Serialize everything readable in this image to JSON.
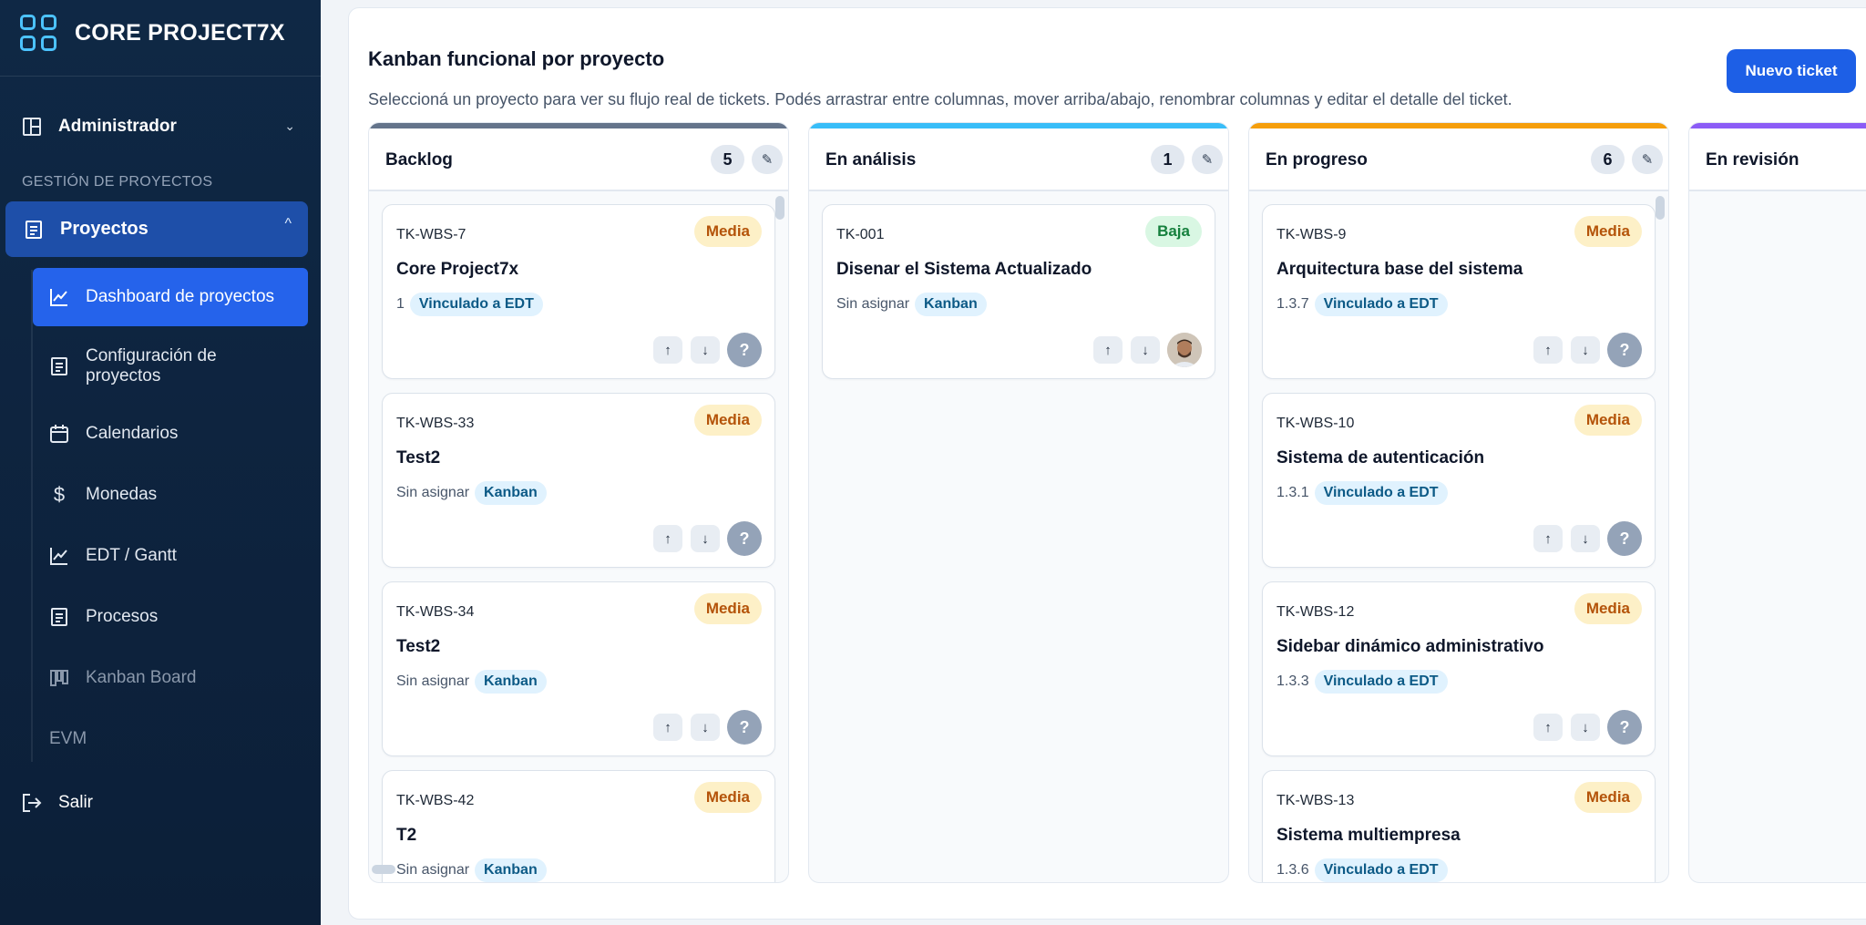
{
  "app": {
    "brand": "CORE PROJECT7X"
  },
  "sidebar": {
    "admin_label": "Administrador",
    "section_title": "GESTIÓN DE PROYECTOS",
    "projects_label": "Proyectos",
    "items": [
      {
        "label": "Dashboard de proyectos",
        "icon": "chart-line-icon"
      },
      {
        "label": "Configuración de proyectos",
        "icon": "document-icon"
      },
      {
        "label": "Calendarios",
        "icon": "calendar-icon"
      },
      {
        "label": "Monedas",
        "icon": "dollar-icon"
      },
      {
        "label": "EDT / Gantt",
        "icon": "chart-line-icon"
      },
      {
        "label": "Procesos",
        "icon": "document-icon"
      },
      {
        "label": "Kanban Board",
        "icon": "kanban-icon"
      },
      {
        "label": "EVM",
        "icon": ""
      }
    ],
    "exit_label": "Salir"
  },
  "main": {
    "title": "Kanban funcional por proyecto",
    "subtitle": "Seleccioná un proyecto para ver su flujo real de tickets. Podés arrastrar entre columnas, mover arriba/abajo, renombrar columnas y editar el detalle del ticket.",
    "new_ticket_label": "Nuevo ticket",
    "edit_symbol": "✎",
    "up_symbol": "↑",
    "down_symbol": "↓",
    "unassigned_symbol": "?"
  },
  "columns": [
    {
      "title": "Backlog",
      "count": "5",
      "accent": "#64748b",
      "cards": [
        {
          "code": "TK-WBS-7",
          "priority": "Media",
          "title": "Core Project7x",
          "meta": "1",
          "tag": "Vinculado a EDT"
        },
        {
          "code": "TK-WBS-33",
          "priority": "Media",
          "title": "Test2",
          "meta": "Sin asignar",
          "tag": "Kanban"
        },
        {
          "code": "TK-WBS-34",
          "priority": "Media",
          "title": "Test2",
          "meta": "Sin asignar",
          "tag": "Kanban"
        },
        {
          "code": "TK-WBS-42",
          "priority": "Media",
          "title": "T2",
          "meta": "Sin asignar",
          "tag": "Kanban"
        }
      ]
    },
    {
      "title": "En análisis",
      "count": "1",
      "accent": "#38bdf8",
      "cards": [
        {
          "code": "TK-001",
          "priority": "Baja",
          "title": "Disenar el Sistema Actualizado",
          "meta": "Sin asignar",
          "tag": "Kanban"
        }
      ]
    },
    {
      "title": "En progreso",
      "count": "6",
      "accent": "#f59e0b",
      "cards": [
        {
          "code": "TK-WBS-9",
          "priority": "Media",
          "title": "Arquitectura base del sistema",
          "meta": "1.3.7",
          "tag": "Vinculado a EDT"
        },
        {
          "code": "TK-WBS-10",
          "priority": "Media",
          "title": "Sistema de autenticación",
          "meta": "1.3.1",
          "tag": "Vinculado a EDT"
        },
        {
          "code": "TK-WBS-12",
          "priority": "Media",
          "title": "Sidebar dinámico administrativo",
          "meta": "1.3.3",
          "tag": "Vinculado a EDT"
        },
        {
          "code": "TK-WBS-13",
          "priority": "Media",
          "title": "Sistema multiempresa",
          "meta": "1.3.6",
          "tag": "Vinculado a EDT"
        }
      ]
    },
    {
      "title": "En revisión",
      "accent": "#8b5cf6",
      "cards": []
    }
  ]
}
